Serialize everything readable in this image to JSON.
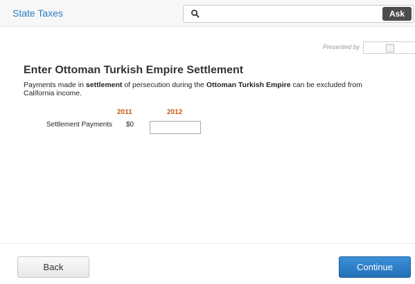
{
  "header": {
    "title": "State Taxes",
    "search": {
      "value": "",
      "placeholder": "",
      "icon": "search-icon"
    },
    "ask_label": "Ask"
  },
  "sponsor": {
    "presented_by": "Presented by"
  },
  "main": {
    "heading": "Enter Ottoman Turkish Empire Settlement",
    "description": {
      "part1": "Payments made in ",
      "bold1": "settlement",
      "part2": " of persecution during the ",
      "bold2": "Ottoman Turkish Empire",
      "part3": " can be excluded from California income."
    },
    "columns": [
      "2011",
      "2012"
    ],
    "row": {
      "label": "Settlement Payments",
      "value_2011": "$0",
      "value_2012": ""
    }
  },
  "footer": {
    "back_label": "Back",
    "continue_label": "Continue"
  },
  "colors": {
    "accent": "#2b7dc2",
    "column_head": "#c45a12",
    "continue_bg": "#2470b8"
  }
}
